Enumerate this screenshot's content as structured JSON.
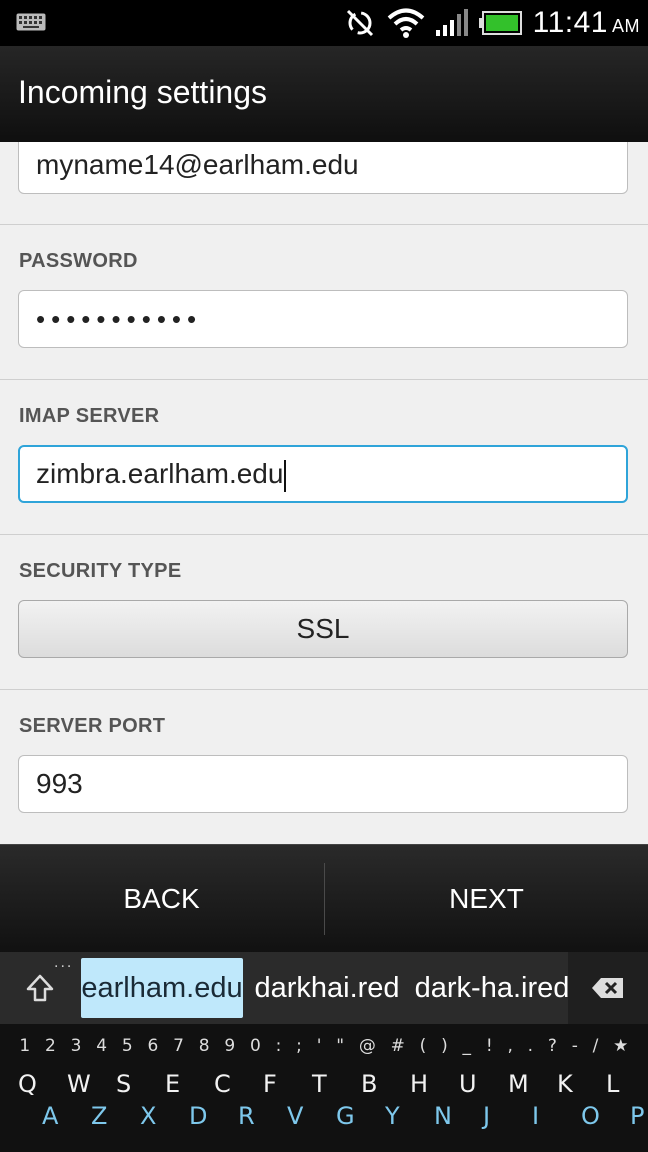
{
  "status_bar": {
    "time": "11:41",
    "ampm": "AM",
    "icons": [
      "keyboard-icon",
      "sync-off-icon",
      "wifi-icon",
      "signal-icon",
      "battery-icon"
    ]
  },
  "header": {
    "title": "Incoming settings"
  },
  "form": {
    "username_value": "myname14@earlham.edu",
    "password_label": "PASSWORD",
    "password_value": "•••••••••••",
    "imap_label": "IMAP SERVER",
    "imap_value": "zimbra.earlham.edu",
    "security_label": "SECURITY TYPE",
    "security_value": "SSL",
    "port_label": "SERVER PORT",
    "port_value": "993"
  },
  "buttons": {
    "back": "BACK",
    "next": "NEXT"
  },
  "suggestions": {
    "more": "...",
    "items": [
      "earlham.edu",
      "darkhai.red",
      "dark-ha.ired"
    ]
  },
  "keyboard": {
    "number_row": [
      "1",
      "2",
      "3",
      "4",
      "5",
      "6",
      "7",
      "8",
      "9",
      "0",
      ":",
      ";",
      "'",
      "\"",
      "@",
      "#",
      "(",
      ")",
      "_",
      "!",
      ",",
      ".",
      "?",
      "-",
      "/",
      "★"
    ],
    "letter_row": [
      "Q",
      "A",
      "W",
      "Z",
      "S",
      "X",
      "E",
      "D",
      "C",
      "R",
      "F",
      "V",
      "T",
      "G",
      "B",
      "Y",
      "H",
      "N",
      "U",
      "J",
      "M",
      "I",
      "K",
      "O",
      "L",
      "P"
    ]
  },
  "colors": {
    "focus_border": "#2fa4d9",
    "suggestion_highlight": "#bfe8fb",
    "keyboard_secondary_letters": "#7ec8ec"
  }
}
